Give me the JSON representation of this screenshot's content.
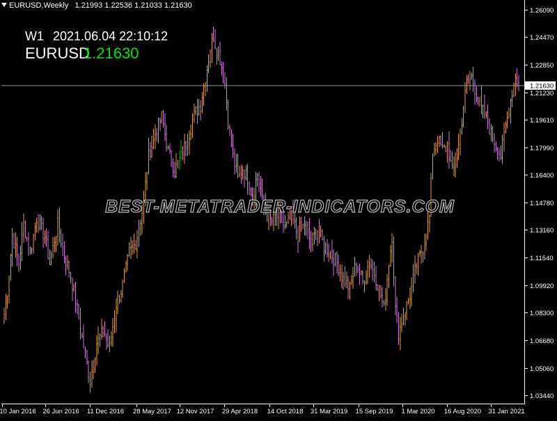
{
  "header": {
    "symbol_label": "EURUSD,Weekly",
    "ohlc": [
      "1.21993",
      "1.22536",
      "1.21033",
      "1.21630"
    ]
  },
  "clock": {
    "timeframe": "W1",
    "datetime": "2021.06.04 22:10:12"
  },
  "price_display": {
    "symbol": "EURUSD",
    "value": "1.21630"
  },
  "watermark": "BEST-METATRADER-INDICATORS.COM",
  "colors": {
    "background": "#000000",
    "bull": "#e0a030",
    "bear": "#d07ad8",
    "current_bar": "#00c000",
    "price_line": "#8a9aaa",
    "axis": "#ffffff",
    "price_text": "#00e600"
  },
  "chart_data": {
    "type": "ohlc",
    "symbol": "EURUSD",
    "timeframe": "Weekly",
    "x_ticks": [
      "10 Jan 2016",
      "26 Jun 2016",
      "11 Dec 2016",
      "28 May 2017",
      "12 Nov 2017",
      "29 Apr 2018",
      "14 Oct 2018",
      "31 Mar 2019",
      "15 Sep 2019",
      "1 Mar 2020",
      "16 Aug 2020",
      "31 Jan 2021"
    ],
    "y_ticks": [
      "1.26090",
      "1.24470",
      "1.22850",
      "1.21230",
      "1.19610",
      "1.17990",
      "1.16400",
      "1.14780",
      "1.13160",
      "1.11540",
      "1.09920",
      "1.08300",
      "1.06680",
      "1.05060",
      "1.03440"
    ],
    "ylim": [
      1.0296,
      1.2665
    ],
    "current_price": 1.2163,
    "current_price_label": "1.21630",
    "waypoints": [
      [
        0,
        1.082
      ],
      [
        2,
        1.096
      ],
      [
        5,
        1.128
      ],
      [
        9,
        1.112
      ],
      [
        12,
        1.135
      ],
      [
        16,
        1.118
      ],
      [
        20,
        1.138
      ],
      [
        25,
        1.128
      ],
      [
        28,
        1.112
      ],
      [
        33,
        1.135
      ],
      [
        37,
        1.116
      ],
      [
        41,
        1.105
      ],
      [
        45,
        1.085
      ],
      [
        49,
        1.063
      ],
      [
        53,
        1.043
      ],
      [
        57,
        1.065
      ],
      [
        61,
        1.072
      ],
      [
        65,
        1.062
      ],
      [
        69,
        1.088
      ],
      [
        73,
        1.099
      ],
      [
        77,
        1.118
      ],
      [
        81,
        1.124
      ],
      [
        85,
        1.142
      ],
      [
        89,
        1.175
      ],
      [
        93,
        1.188
      ],
      [
        97,
        1.198
      ],
      [
        101,
        1.178
      ],
      [
        105,
        1.166
      ],
      [
        109,
        1.175
      ],
      [
        113,
        1.185
      ],
      [
        117,
        1.199
      ],
      [
        121,
        1.205
      ],
      [
        124,
        1.221
      ],
      [
        127,
        1.238
      ],
      [
        129,
        1.245
      ],
      [
        131,
        1.238
      ],
      [
        133,
        1.232
      ],
      [
        136,
        1.218
      ],
      [
        138,
        1.196
      ],
      [
        141,
        1.175
      ],
      [
        144,
        1.161
      ],
      [
        147,
        1.168
      ],
      [
        150,
        1.162
      ],
      [
        153,
        1.151
      ],
      [
        156,
        1.165
      ],
      [
        159,
        1.149
      ],
      [
        162,
        1.141
      ],
      [
        165,
        1.136
      ],
      [
        169,
        1.141
      ],
      [
        173,
        1.132
      ],
      [
        177,
        1.139
      ],
      [
        181,
        1.128
      ],
      [
        185,
        1.135
      ],
      [
        189,
        1.124
      ],
      [
        193,
        1.132
      ],
      [
        197,
        1.122
      ],
      [
        201,
        1.118
      ],
      [
        205,
        1.112
      ],
      [
        209,
        1.103
      ],
      [
        213,
        1.097
      ],
      [
        217,
        1.113
      ],
      [
        221,
        1.101
      ],
      [
        225,
        1.113
      ],
      [
        228,
        1.106
      ],
      [
        231,
        1.097
      ],
      [
        234,
        1.085
      ],
      [
        237,
        1.112
      ],
      [
        239,
        1.128
      ],
      [
        241,
        1.085
      ],
      [
        243,
        1.071
      ],
      [
        246,
        1.082
      ],
      [
        250,
        1.093
      ],
      [
        254,
        1.111
      ],
      [
        258,
        1.122
      ],
      [
        262,
        1.139
      ],
      [
        264,
        1.178
      ],
      [
        267,
        1.185
      ],
      [
        270,
        1.178
      ],
      [
        273,
        1.181
      ],
      [
        276,
        1.165
      ],
      [
        279,
        1.175
      ],
      [
        282,
        1.196
      ],
      [
        285,
        1.218
      ],
      [
        288,
        1.221
      ],
      [
        291,
        1.212
      ],
      [
        294,
        1.203
      ],
      [
        297,
        1.198
      ],
      [
        300,
        1.188
      ],
      [
        303,
        1.182
      ],
      [
        306,
        1.175
      ],
      [
        309,
        1.192
      ],
      [
        312,
        1.208
      ],
      [
        315,
        1.222
      ],
      [
        317,
        1.216
      ]
    ]
  }
}
